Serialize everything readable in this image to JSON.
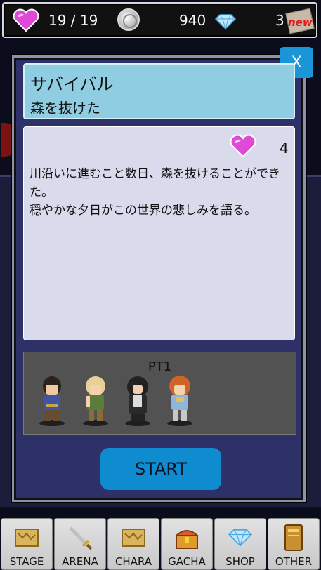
{
  "status": {
    "hp": "19 / 19",
    "coins": "940",
    "gems": "3",
    "new_badge": "new"
  },
  "modal": {
    "close_label": "X",
    "title": "サバイバル",
    "subtitle": "森を抜けた",
    "cost": "4",
    "description": "川沿いに進むこと数日、森を抜けることができた。\n穏やかな夕日がこの世界の悲しみを語る。",
    "party_label": "PT1",
    "start_label": "START"
  },
  "nav": {
    "items": [
      {
        "label": "STAGE",
        "icon": "map-scroll-icon"
      },
      {
        "label": "ARENA",
        "icon": "sword-icon"
      },
      {
        "label": "CHARA",
        "icon": "map-scroll-icon"
      },
      {
        "label": "GACHA",
        "icon": "treasure-chest-icon"
      },
      {
        "label": "SHOP",
        "icon": "diamond-icon"
      },
      {
        "label": "OTHER",
        "icon": "book-icon"
      }
    ]
  },
  "colors": {
    "accent": "#1a96d8",
    "heart": "#e048d8",
    "modal_bg": "#2e3068",
    "title_bg": "#8fcde2"
  }
}
